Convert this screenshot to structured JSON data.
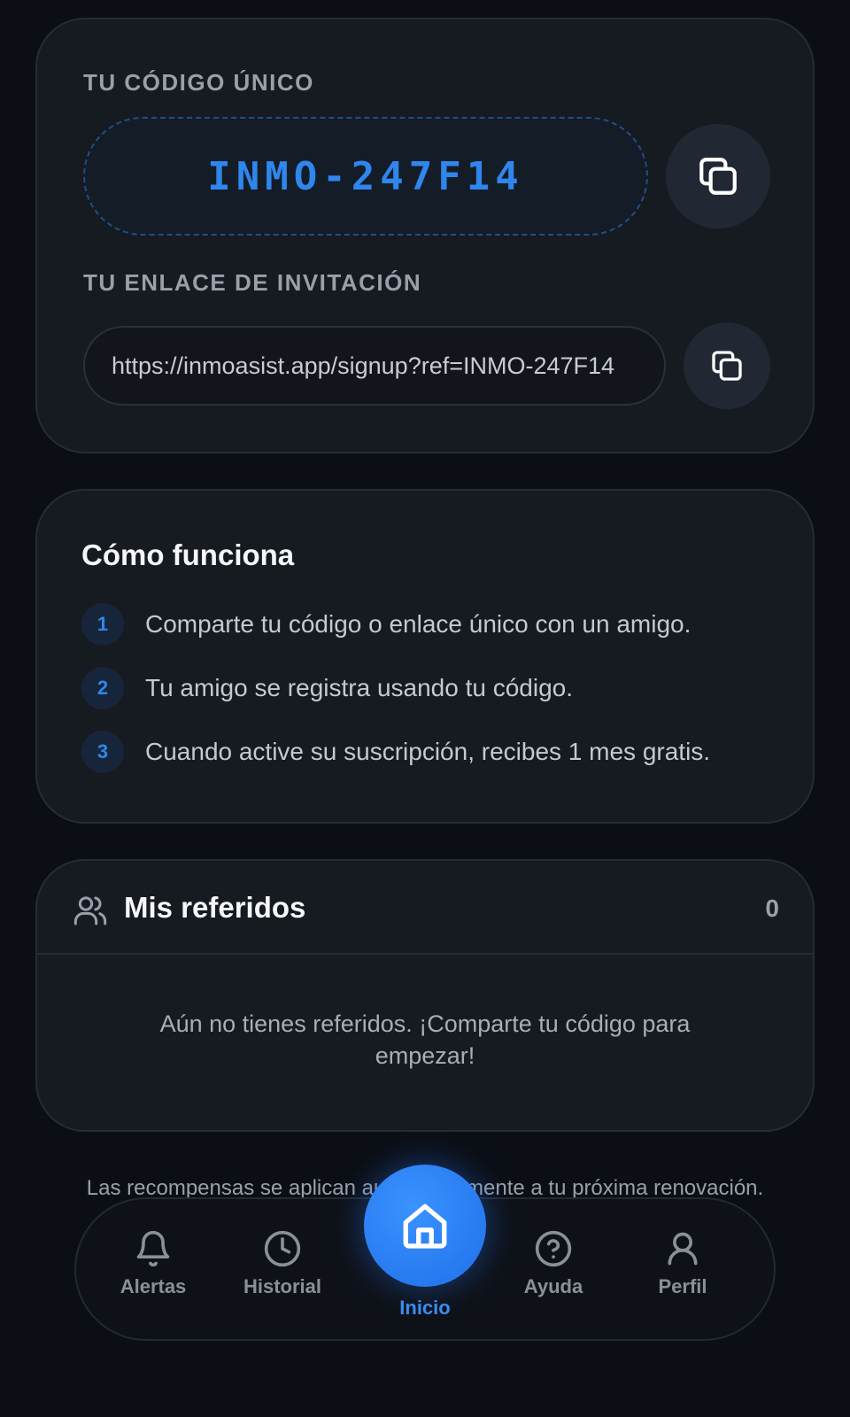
{
  "code_card": {
    "code_label": "TU CÓDIGO ÚNICO",
    "code": "INMO-247F14",
    "link_label": "TU ENLACE DE INVITACIÓN",
    "link": "https://inmoasist.app/signup?ref=INMO-247F14"
  },
  "how": {
    "title": "Cómo funciona",
    "steps": [
      {
        "num": "1",
        "text": "Comparte tu código o enlace único con un amigo."
      },
      {
        "num": "2",
        "text": "Tu amigo se registra usando tu código."
      },
      {
        "num": "3",
        "text": "Cuando active su suscripción, recibes 1 mes gratis."
      }
    ]
  },
  "referrals": {
    "title": "Mis referidos",
    "count": "0",
    "empty": "Aún no tienes referidos. ¡Comparte tu código para empezar!"
  },
  "footer_note": "Las recompensas se aplican automáticamente a tu próxima renovación.",
  "nav": {
    "alerts": "Alertas",
    "history": "Historial",
    "home": "Inicio",
    "help": "Ayuda",
    "profile": "Perfil"
  },
  "colors": {
    "accent": "#2f86ec",
    "background": "#0b0e14",
    "card": "#161a21"
  }
}
